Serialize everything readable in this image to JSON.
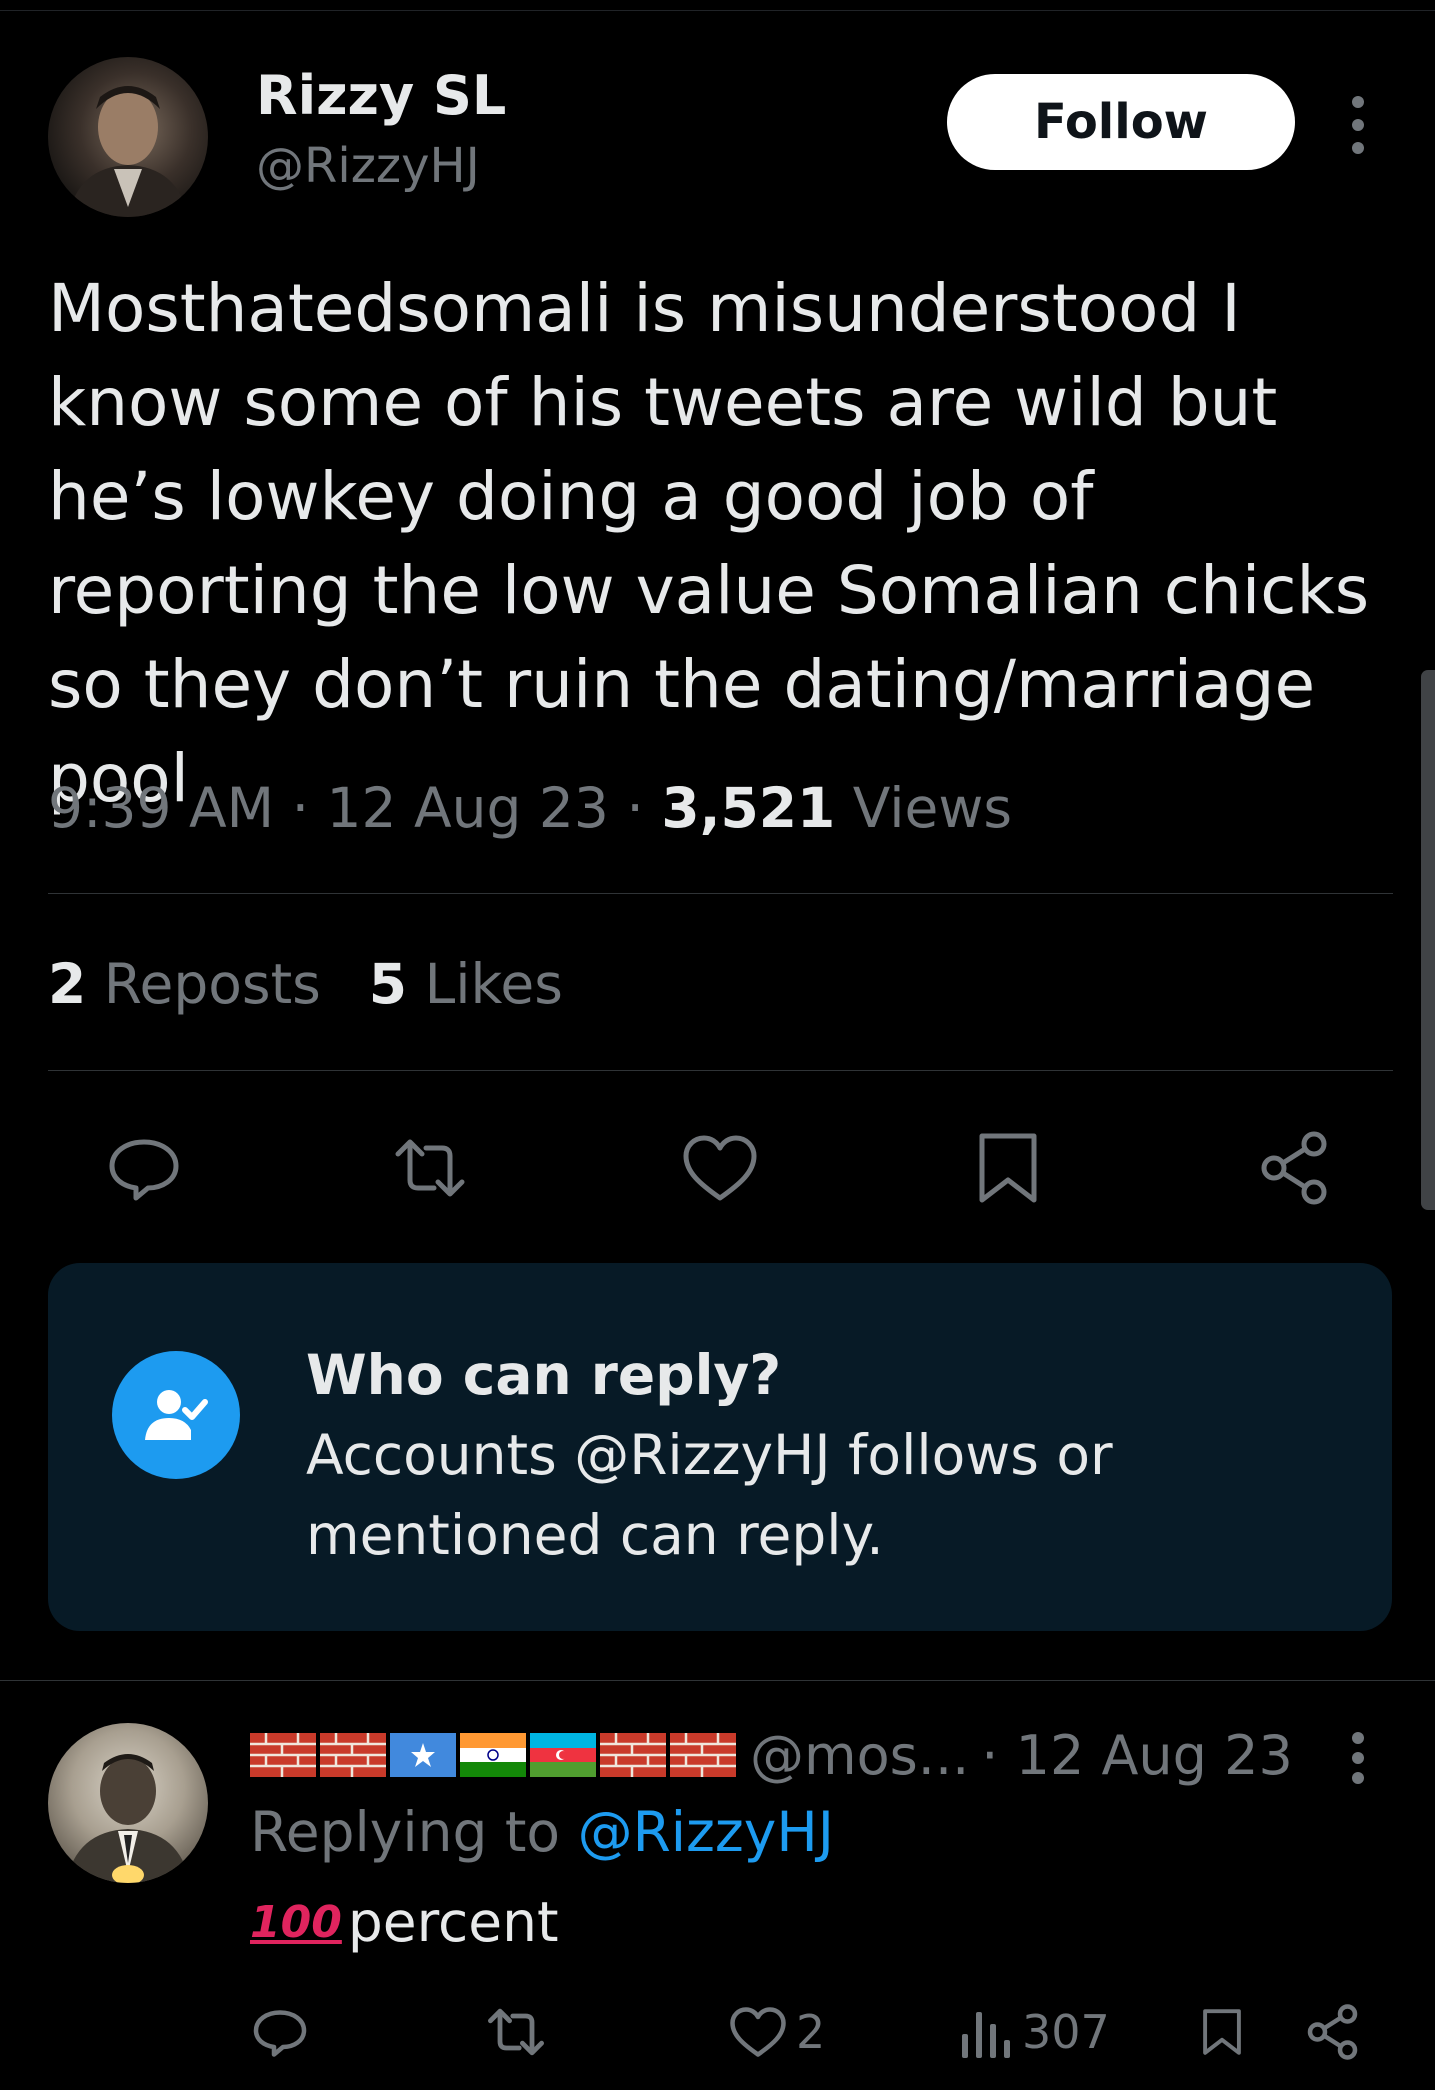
{
  "tweet": {
    "display_name": "Rizzy SL",
    "handle": "@RizzyHJ",
    "follow_label": "Follow",
    "text": "Mosthatedsomali is misunderstood I know some of his tweets are wild but he’s lowkey doing a good job of reporting the low value Somalian chicks so they don’t ruin the dating/marriage pool",
    "time": "9:39 AM",
    "date": "12 Aug 23",
    "views_count": "3,521",
    "views_label": "Views",
    "reposts_count": "2",
    "reposts_label": "Reposts",
    "likes_count": "5",
    "likes_label": "Likes"
  },
  "reply_restriction": {
    "title": "Who can reply?",
    "body": "Accounts @RizzyHJ follows or mentioned can reply."
  },
  "reply": {
    "handle": "@mos...",
    "date": "· 12 Aug 23",
    "replying_prefix": "Replying to",
    "replying_handle": "@RizzyHJ",
    "emoji_text": "100",
    "text": "percent",
    "likes": "2",
    "views": "307"
  },
  "colors": {
    "background": "#000000",
    "text": "#e7e9ea",
    "muted": "#71767b",
    "accent": "#1d9bf0",
    "card": "#071a26"
  },
  "icons": [
    "more-vertical-icon",
    "reply-icon",
    "repost-icon",
    "heart-icon",
    "bookmark-icon",
    "share-icon",
    "user-check-icon",
    "views-icon",
    "brick-wall-icon",
    "somalia-flag-icon",
    "india-flag-icon",
    "azerbaijan-flag-icon"
  ]
}
